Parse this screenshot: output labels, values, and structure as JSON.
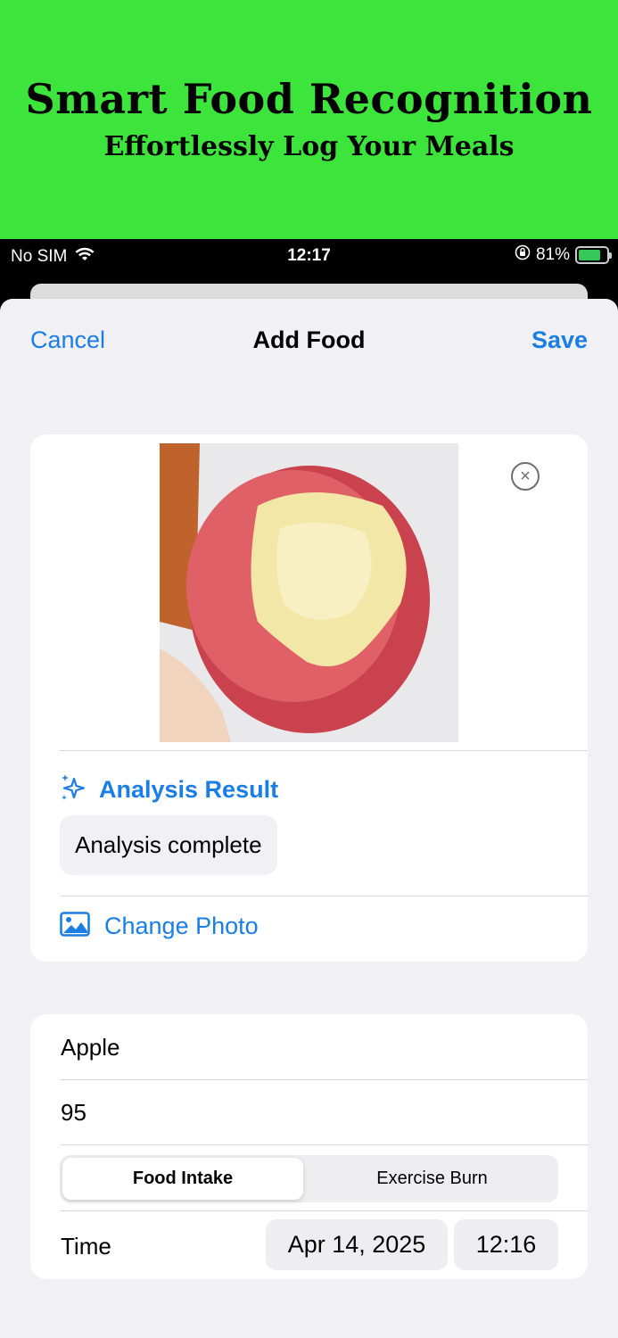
{
  "banner": {
    "title": "Smart Food Recognition",
    "subtitle": "Effortlessly Log Your Meals",
    "background": "#3ce43c"
  },
  "status_bar": {
    "carrier": "No SIM",
    "time": "12:17",
    "battery": "81%",
    "battery_level": 0.81
  },
  "nav": {
    "cancel": "Cancel",
    "title": "Add Food",
    "save": "Save"
  },
  "photo_card": {
    "analysis_title": "Analysis Result",
    "analysis_status": "Analysis complete",
    "change_photo": "Change Photo"
  },
  "form": {
    "name_value": "Apple",
    "calories_value": "95",
    "segments": [
      "Food Intake",
      "Exercise Burn"
    ],
    "selected_segment": "Food Intake",
    "time_label": "Time",
    "date": "Apr 14, 2025",
    "time": "12:16"
  },
  "colors": {
    "accent": "#1a7ee6",
    "sheet_bg": "#f0f0f5",
    "card_bg": "#ffffff"
  }
}
